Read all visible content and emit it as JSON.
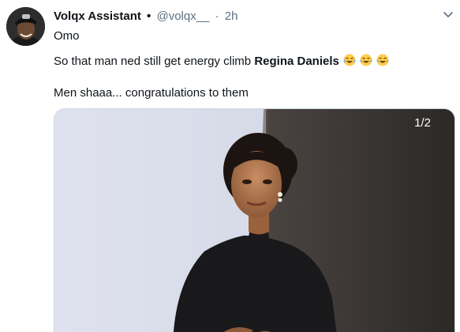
{
  "tweet": {
    "author_name": "Volqx Assistant",
    "author_dot": "•",
    "handle": "@volqx__",
    "time_sep": "·",
    "time": "2h",
    "lines": {
      "line1": "Omo",
      "line2_prefix": "So that man ned still get energy climb",
      "line2_mention": "Regina Daniels",
      "line3": "Men shaaa... congratulations to them"
    },
    "emojis": [
      "laughing-crying-emoji",
      "laughing-crying-emoji",
      "laughing-crying-emoji"
    ],
    "media": {
      "counter": "1/2",
      "image_alt": "photo"
    }
  },
  "colors": {
    "text": "#0f1419",
    "secondary": "#5b7083",
    "backdrop_light": "#d7dbe8",
    "backdrop_dark": "#3a3634",
    "dress": "#171719"
  }
}
